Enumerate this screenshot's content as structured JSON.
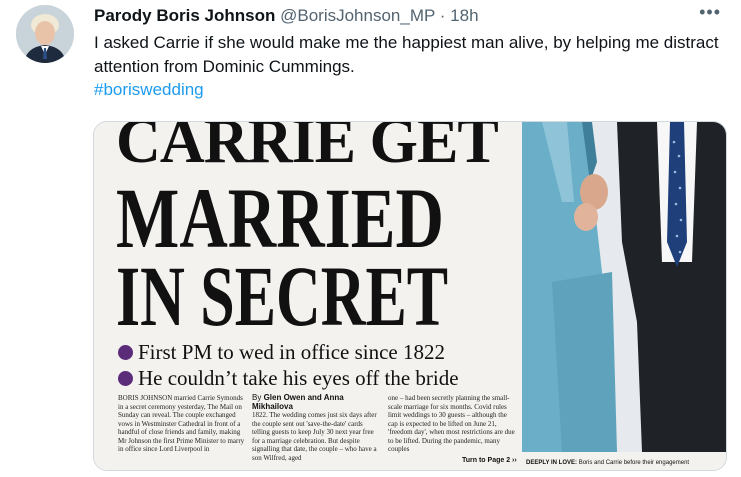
{
  "author": {
    "name": "Parody Boris Johnson",
    "handle": "@BorisJohnson_MP",
    "separator": "·",
    "time": "18h"
  },
  "more_icon": "more-horizontal-icon",
  "tweet_text": "I asked Carrie if she would make me the happiest man alive, by helping me distract attention from Dominic Cummings.",
  "hashtag": "#boriswedding",
  "newspaper": {
    "headline_line1": "CARRIE GET",
    "headline_line2": "MARRIED",
    "headline_line3": "IN SECRET",
    "bullet1": "First PM to wed in office since 1822",
    "bullet2": "He couldn’t take his eyes off the bride",
    "bullet_color": "#5b2c7a",
    "col1": "BORIS JOHNSON married Carrie Symonds in a secret ceremony yesterday, The Mail on Sunday can reveal. The couple exchanged vows in Westminster Cathedral in front of a handful of close friends and family, making Mr Johnson the first Prime Minister to marry in office since Lord Liverpool in",
    "byline_by": "By",
    "byline_names": "Glen Owen and Anna Mikhailova",
    "col2": "1822. The wedding comes just six days after the couple sent out 'save-the-date' cards telling guests to keep July 30 next year free for a marriage celebration. But despite signalling that date, the couple – who have a son Wilfred, aged",
    "col3": "one – had been secretly planning the small-scale marriage for six months. Covid rules limit weddings to 30 guests – although the cap is expected to be lifted on June 21, 'freedom day', when most restrictions are due to be lifted. During the pandemic, many couples",
    "turn_to": "Turn to Page 2 ››",
    "caption_key": "DEEPLY IN LOVE:",
    "caption_text": "Boris and Carrie before their engagement"
  }
}
